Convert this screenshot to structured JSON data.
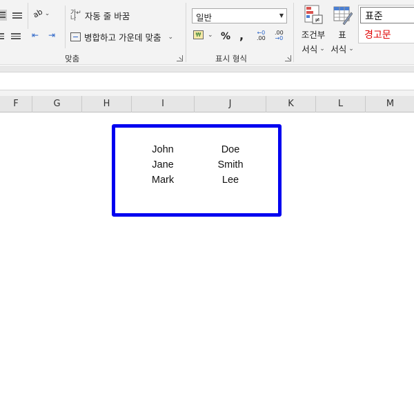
{
  "ribbon": {
    "alignment": {
      "wrap_text_label": "자동 줄 바꿈",
      "merge_center_label": "병합하고 가운데 맞춤",
      "group_label": "맞춤",
      "orientation_icon": "text-orientation-icon",
      "indent_icons": [
        "decrease-indent-icon",
        "increase-indent-icon"
      ]
    },
    "number": {
      "format_value": "일반",
      "group_label": "표시 형식",
      "percent_label": "%",
      "comma_label": ",",
      "increase_decimal_label": ".00",
      "decrease_decimal_label": ".00"
    },
    "styles": {
      "conditional_formatting_line1": "조건부",
      "conditional_formatting_line2": "서식",
      "format_table_line1": "표",
      "format_table_line2": "서식",
      "cell_styles": [
        "표준",
        "경고문"
      ]
    }
  },
  "columns": [
    "F",
    "G",
    "H",
    "I",
    "J",
    "K",
    "L",
    "M"
  ],
  "cells": {
    "first_names": [
      "John",
      "Jane",
      "Mark"
    ],
    "last_names": [
      "Doe",
      "Smith",
      "Lee"
    ]
  },
  "colors": {
    "highlight_border": "#0000f0",
    "warning_text": "#e00000"
  }
}
